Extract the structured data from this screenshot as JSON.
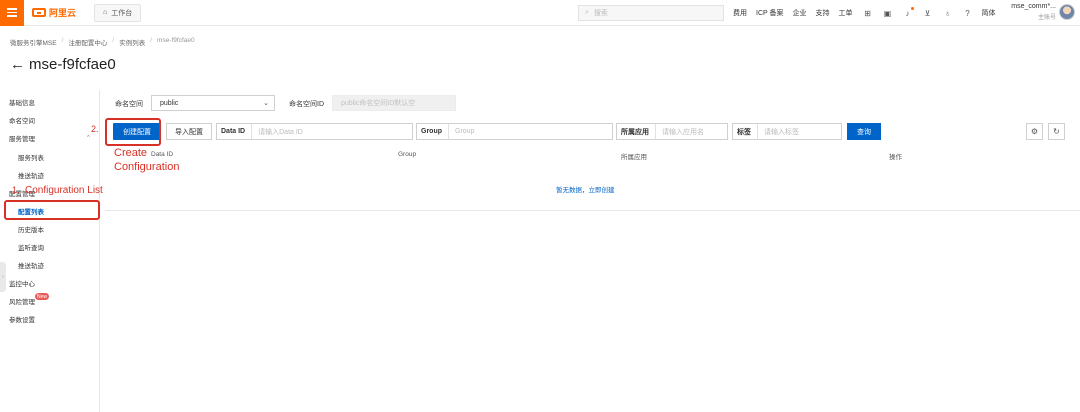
{
  "topbar": {
    "logo_text": "阿里云",
    "workbench": "工作台",
    "search_placeholder": "搜索",
    "links": [
      "费用",
      "ICP 备案",
      "企业",
      "支持",
      "工单"
    ],
    "lang": "简体",
    "account_name": "mse_comm*...",
    "account_role": "主账号",
    "brand_color": "#ff6a00"
  },
  "breadcrumb": [
    "微服务引擎MSE",
    "注册配置中心",
    "实例列表",
    "mse-f9fcfae0"
  ],
  "page_title": "mse-f9fcfae0",
  "sidebar": {
    "items": [
      {
        "label": "基础信息",
        "level": 1
      },
      {
        "label": "命名空间",
        "level": 1
      },
      {
        "label": "服务管理",
        "level": 1
      },
      {
        "label": "服务列表",
        "level": 2
      },
      {
        "label": "推送轨迹",
        "level": 2
      },
      {
        "label": "配置管理",
        "level": 1
      },
      {
        "label": "配置列表",
        "level": 2,
        "active": true
      },
      {
        "label": "历史版本",
        "level": 2
      },
      {
        "label": "监听查询",
        "level": 2
      },
      {
        "label": "推送轨迹",
        "level": 2
      },
      {
        "label": "监控中心",
        "level": 1
      },
      {
        "label": "风险管理",
        "level": 1,
        "badge": "New"
      },
      {
        "label": "参数设置",
        "level": 1
      }
    ]
  },
  "filters": {
    "namespace_label": "命名空间",
    "namespace_value": "public",
    "namespace_id_label": "命名空间ID",
    "namespace_id_placeholder": "public命名空间ID默认空",
    "create_button": "创建配置",
    "import_button": "导入配置",
    "data_id_label": "Data ID",
    "data_id_placeholder": "请输入Data ID",
    "group_label": "Group",
    "group_placeholder": "Group",
    "app_label": "所属应用",
    "app_placeholder": "请输入应用名",
    "tag_label": "标签",
    "tag_placeholder": "请输入标签",
    "query_button": "查询"
  },
  "table": {
    "columns": [
      "Data ID",
      "Group",
      "所属应用",
      "操作"
    ],
    "empty_text": "暂无数据，立即创建"
  },
  "annotations": {
    "step1_prefix": "1.",
    "step1_text": "Configuration List",
    "step2_prefix": "2.",
    "step2_line1": "Create",
    "step2_line2": "Configuration",
    "color": "#d93026"
  }
}
